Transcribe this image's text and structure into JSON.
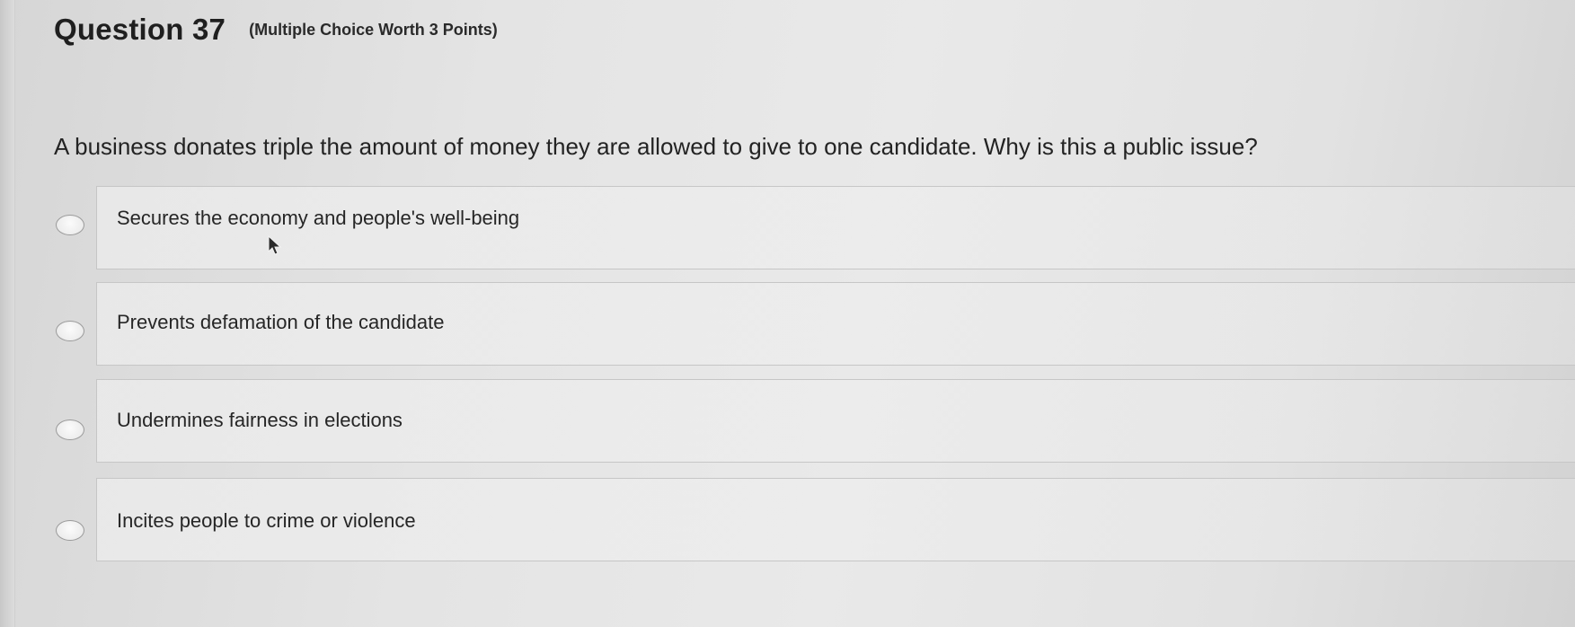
{
  "question": {
    "number_label": "Question 37",
    "meta_label": "(Multiple Choice Worth 3 Points)",
    "prompt": "A business donates triple the amount of money they are allowed to give to one candidate. Why is this a public issue?"
  },
  "options": [
    {
      "label": "Secures the economy and people's well-being",
      "selected": false
    },
    {
      "label": "Prevents defamation of the candidate",
      "selected": false
    },
    {
      "label": "Undermines fairness in elections",
      "selected": false
    },
    {
      "label": "Incites people to crime or violence",
      "selected": false
    }
  ],
  "icons": {
    "radio": "radio-unchecked-icon",
    "cursor": "mouse-pointer-icon"
  },
  "colors": {
    "background": "#e4e4e4",
    "text": "#222222",
    "border": "#c6c6c6"
  }
}
